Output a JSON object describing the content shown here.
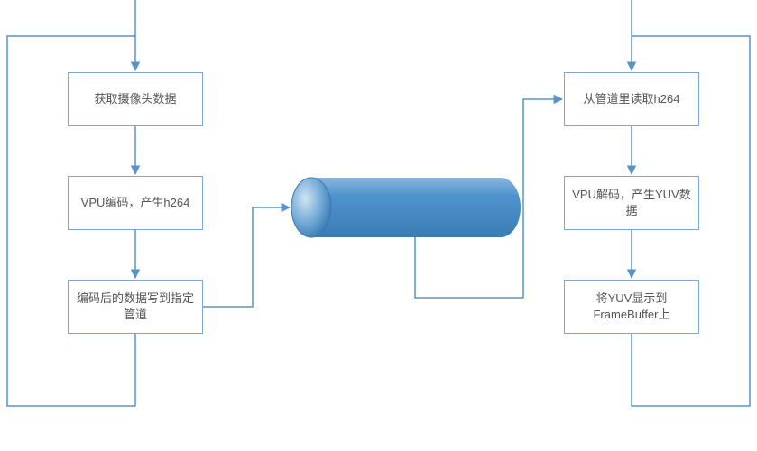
{
  "diagram": {
    "left": {
      "step1": "获取摄像头数据",
      "step2": "VPU编码，产生h264",
      "step3": "编码后的数据写到指定管道"
    },
    "right": {
      "step1": "从管道里读取h264",
      "step2": "VPU解码，产生YUV数据",
      "step3": "将YUV显示到FrameBuffer上"
    },
    "pipe_label": ""
  },
  "colors": {
    "border": "#7da7d9",
    "arrow": "#5a93c8",
    "pipe_fill": "#4f94cd",
    "pipe_highlight": "#a6c7e6"
  }
}
